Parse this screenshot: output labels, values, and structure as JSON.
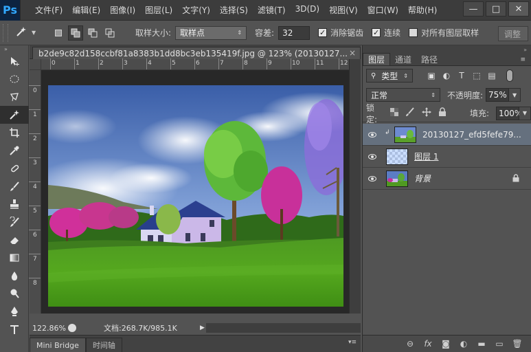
{
  "app": {
    "logo": "Ps",
    "menu": [
      "文件(F)",
      "编辑(E)",
      "图像(I)",
      "图层(L)",
      "文字(Y)",
      "选择(S)",
      "滤镜(T)",
      "3D(D)",
      "视图(V)",
      "窗口(W)",
      "帮助(H)"
    ],
    "window_buttons": {
      "minimize": "—",
      "restore": "□",
      "close": "✕"
    }
  },
  "options": {
    "sample_size_label": "取样大小:",
    "sample_size_value": "取样点",
    "tolerance_label": "容差:",
    "tolerance_value": "32",
    "antialias_label": "消除锯齿",
    "antialias_checked": true,
    "contiguous_label": "连续",
    "contiguous_checked": true,
    "sample_all_label": "对所有图层取样",
    "sample_all_checked": false,
    "refine_edge_label": "调整"
  },
  "document": {
    "tab_title": "b2de9c82d158ccbf81a8383b1dd8bc3eb135419f.jpg @ 123% (20130127...",
    "ruler_h_ticks": [
      "0",
      "1",
      "2",
      "3",
      "4",
      "5",
      "6",
      "7",
      "8",
      "9",
      "10",
      "11",
      "12"
    ],
    "ruler_v_ticks": [
      "0",
      "1",
      "2",
      "3",
      "4",
      "5",
      "6",
      "7",
      "8"
    ],
    "zoom": "122.86%",
    "doc_info": "文档:268.7K/985.1K"
  },
  "bottom_tabs": [
    "Mini Bridge",
    "时间轴"
  ],
  "layers_panel": {
    "tabs": [
      "图层",
      "通道",
      "路径"
    ],
    "filter_kind": "类型",
    "blend_mode": "正常",
    "opacity_label": "不透明度:",
    "opacity_value": "75%",
    "lock_label": "锁定:",
    "fill_label": "填充:",
    "fill_value": "100%",
    "layers": [
      {
        "name": "20130127_efd5fefe79...",
        "selected": true,
        "clipped": true,
        "visible": true
      },
      {
        "name": "图层 1",
        "selected": false,
        "visible": true
      },
      {
        "name": "背景",
        "selected": false,
        "visible": true,
        "locked": true
      }
    ]
  },
  "colors": {
    "ui_bg": "#535353",
    "menubar": "#3c3c3c",
    "selected_layer": "#65707e",
    "ps_blue": "#31a8ff"
  }
}
